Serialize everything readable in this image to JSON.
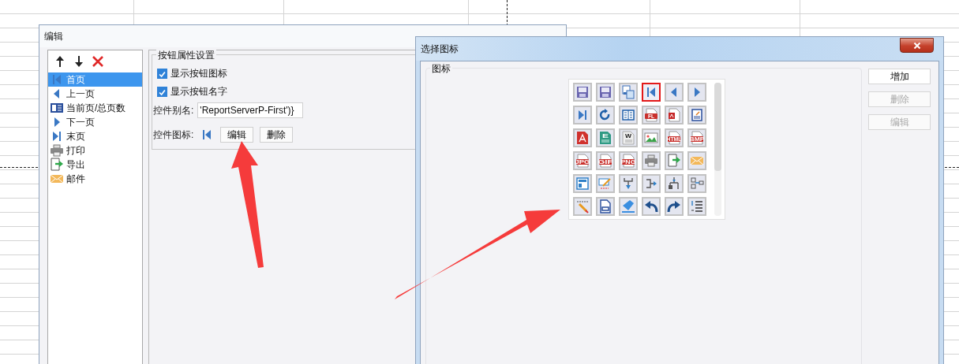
{
  "edit_dialog": {
    "title": "编辑",
    "toolbar": [
      {
        "kind": "up"
      },
      {
        "kind": "down"
      },
      {
        "kind": "delete"
      }
    ],
    "items": [
      {
        "label": "首页",
        "kind": "first",
        "selected": true
      },
      {
        "label": "上一页",
        "kind": "prev",
        "selected": false
      },
      {
        "label": "当前页/总页数",
        "kind": "pagecount",
        "selected": false
      },
      {
        "label": "下一页",
        "kind": "next",
        "selected": false
      },
      {
        "label": "末页",
        "kind": "last",
        "selected": false
      },
      {
        "label": "打印",
        "kind": "printer",
        "selected": false
      },
      {
        "label": "导出",
        "kind": "export",
        "selected": false
      },
      {
        "label": "邮件",
        "kind": "mail",
        "selected": false
      }
    ],
    "group_title": "按钮属性设置",
    "checkboxes": [
      {
        "label": "显示按钮图标",
        "checked": true
      },
      {
        "label": "显示按钮名字",
        "checked": true
      }
    ],
    "alias": {
      "label": "控件别名:",
      "value": "'ReportServerP-First')}"
    },
    "icon_row": {
      "label": "控件图标:",
      "kind": "first",
      "buttons": [
        "编辑",
        "删除"
      ]
    }
  },
  "icon_dialog": {
    "title": "选择图标",
    "group_title": "图标",
    "icons": [
      {
        "kind": "save",
        "selected": false
      },
      {
        "kind": "save",
        "selected": false
      },
      {
        "kind": "copy",
        "selected": false
      },
      {
        "kind": "first",
        "selected": true
      },
      {
        "kind": "prev",
        "selected": false
      },
      {
        "kind": "next",
        "selected": false
      },
      {
        "kind": "last",
        "selected": false
      },
      {
        "kind": "refresh",
        "selected": false
      },
      {
        "kind": "book",
        "selected": false
      },
      {
        "kind": "file",
        "badge": "FL",
        "selected": false
      },
      {
        "kind": "pdf-file",
        "selected": false
      },
      {
        "kind": "edit-doc",
        "selected": false
      },
      {
        "kind": "pdf",
        "selected": false
      },
      {
        "kind": "sheet",
        "badge": "E",
        "selected": false
      },
      {
        "kind": "word",
        "badge": "W",
        "selected": false
      },
      {
        "kind": "image",
        "selected": false
      },
      {
        "kind": "file",
        "badge": "HTML",
        "selected": false
      },
      {
        "kind": "file",
        "badge": "BMP",
        "selected": false
      },
      {
        "kind": "file",
        "badge": "JPG",
        "selected": false
      },
      {
        "kind": "file",
        "badge": "GIF",
        "selected": false
      },
      {
        "kind": "file",
        "badge": "PNG",
        "selected": false
      },
      {
        "kind": "printer",
        "selected": false
      },
      {
        "kind": "export",
        "selected": false
      },
      {
        "kind": "mail",
        "selected": false
      },
      {
        "kind": "layout",
        "selected": false
      },
      {
        "kind": "form-edit",
        "selected": false
      },
      {
        "kind": "merge-down",
        "selected": false
      },
      {
        "kind": "split-right",
        "selected": false
      },
      {
        "kind": "tree-down",
        "selected": false
      },
      {
        "kind": "tree-left",
        "selected": false
      },
      {
        "kind": "pencil",
        "selected": false
      },
      {
        "kind": "doc-link",
        "selected": false
      },
      {
        "kind": "paint",
        "selected": false
      },
      {
        "kind": "undo",
        "selected": false
      },
      {
        "kind": "redo",
        "selected": false
      },
      {
        "kind": "list",
        "selected": false
      }
    ],
    "buttons": [
      {
        "label": "增加",
        "disabled": false
      },
      {
        "label": "删除",
        "disabled": true
      },
      {
        "label": "编辑",
        "disabled": true
      }
    ]
  }
}
